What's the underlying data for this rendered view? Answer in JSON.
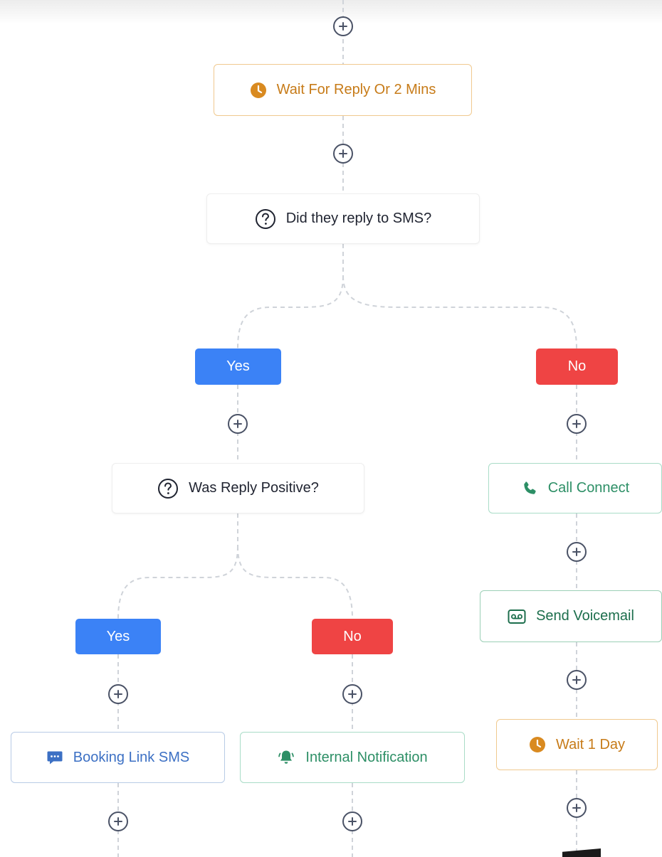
{
  "colors": {
    "yes": "#3b82f6",
    "no": "#ef4444",
    "wait": "#c77b18",
    "connector": "#cfd3d9",
    "plus": "#4a5266"
  },
  "nodes": {
    "wait_reply": {
      "label": "Wait For Reply Or 2 Mins",
      "icon": "clock-icon"
    },
    "did_reply": {
      "label": "Did they reply to SMS?",
      "icon": "question-icon"
    },
    "was_positive": {
      "label": "Was Reply Positive?",
      "icon": "question-icon"
    },
    "call_connect": {
      "label": "Call Connect",
      "icon": "phone-icon"
    },
    "send_voicemail": {
      "label": "Send Voicemail",
      "icon": "voicemail-icon"
    },
    "wait_day": {
      "label": "Wait 1 Day",
      "icon": "clock-icon"
    },
    "booking_sms": {
      "label": "Booking Link SMS",
      "icon": "chat-icon"
    },
    "internal_notification": {
      "label": "Internal Notification",
      "icon": "bell-icon"
    }
  },
  "branches": {
    "reply_yes": "Yes",
    "reply_no": "No",
    "positive_yes": "Yes",
    "positive_no": "No"
  },
  "add_step_icon": "plus-circle-icon"
}
